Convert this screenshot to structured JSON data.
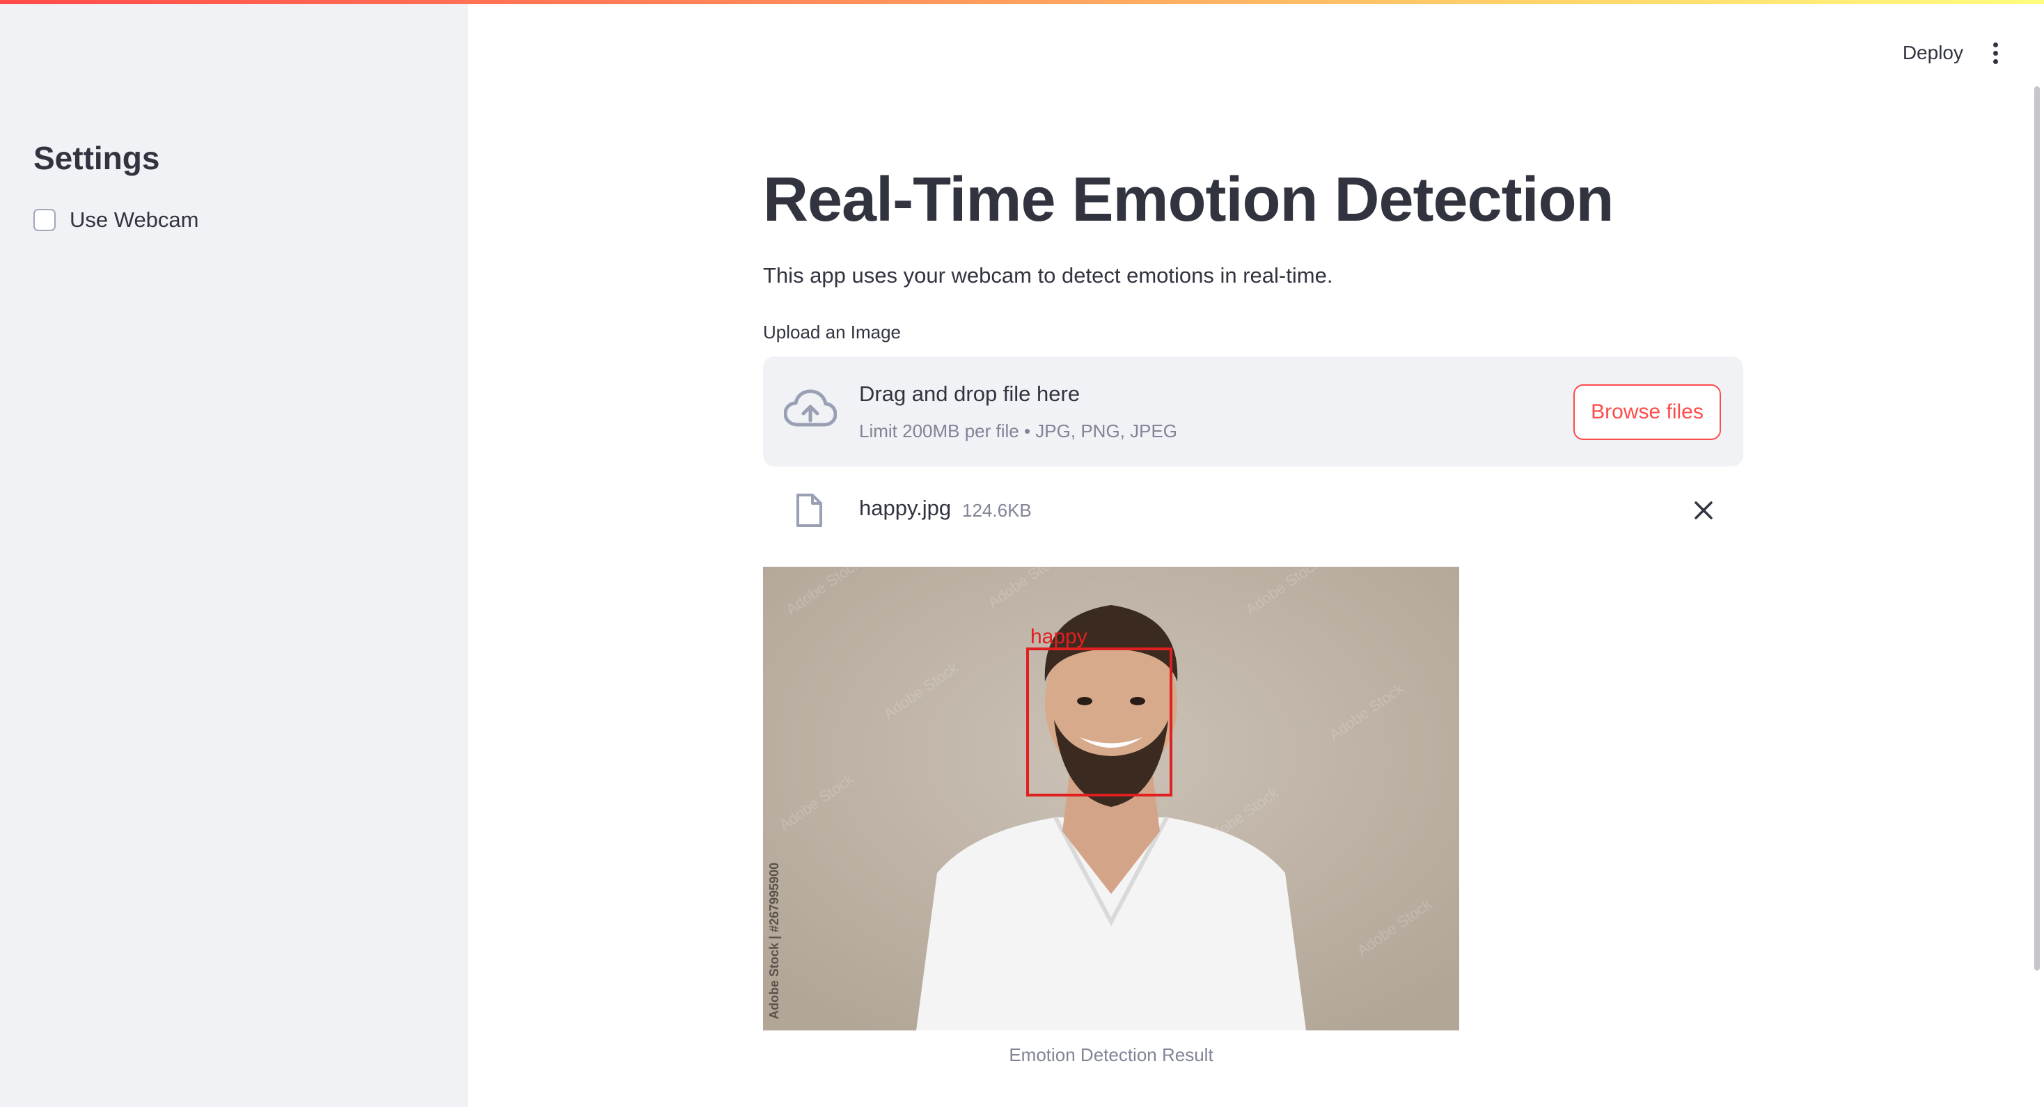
{
  "sidebar": {
    "title": "Settings",
    "webcam_label": "Use Webcam",
    "webcam_checked": false
  },
  "header": {
    "deploy_label": "Deploy"
  },
  "main": {
    "title": "Real-Time Emotion Detection",
    "description": "This app uses your webcam to detect emotions in real-time.",
    "upload_label": "Upload an Image",
    "dropzone": {
      "main_text": "Drag and drop file here",
      "sub_text": "Limit 200MB per file • JPG, PNG, JPEG",
      "browse_label": "Browse files"
    },
    "file": {
      "name": "happy.jpg",
      "size": "124.6KB"
    },
    "result": {
      "emotion_label": "happy",
      "watermark": "Adobe Stock",
      "stock_id": "Adobe Stock | #267995900",
      "caption": "Emotion Detection Result"
    }
  },
  "colors": {
    "accent": "#ff4b4b",
    "sidebar_bg": "#f0f2f6",
    "text": "#31333f",
    "muted": "#808495",
    "box": "#e02020"
  }
}
